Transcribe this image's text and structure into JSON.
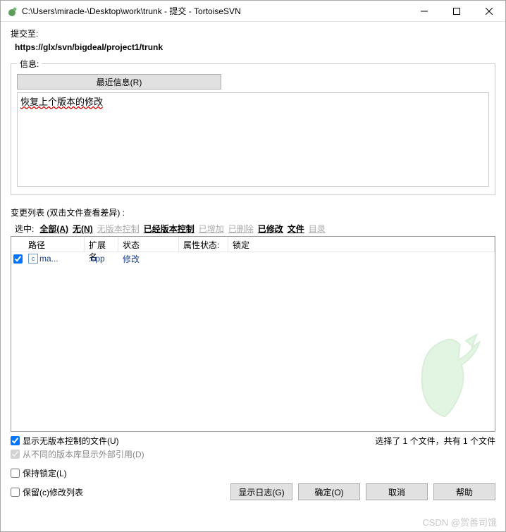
{
  "titlebar": {
    "text": "C:\\Users\\miracle-\\Desktop\\work\\trunk - 提交 - TortoiseSVN"
  },
  "commit": {
    "to_label": "提交至:",
    "url": "https://glx/svn/bigdeal/project1/trunk"
  },
  "info": {
    "legend": "信息:",
    "recent_btn": "最近信息(R)",
    "message": "恢复上个版本的修改"
  },
  "changelist": {
    "label": "变更列表  (双击文件查看差异) :",
    "filter_label": "选中:",
    "filters": [
      {
        "label": "全部(A)",
        "bold": true,
        "disabled": false
      },
      {
        "label": "无(N)",
        "bold": true,
        "disabled": false
      },
      {
        "label": "无版本控制",
        "bold": false,
        "disabled": true
      },
      {
        "label": "已经版本控制",
        "bold": true,
        "disabled": false
      },
      {
        "label": "已增加",
        "bold": false,
        "disabled": true
      },
      {
        "label": "已删除",
        "bold": false,
        "disabled": true
      },
      {
        "label": "已修改",
        "bold": true,
        "disabled": false
      },
      {
        "label": "文件",
        "bold": true,
        "disabled": false
      },
      {
        "label": "目录",
        "bold": false,
        "disabled": true
      }
    ]
  },
  "filelist": {
    "headers": {
      "path": "路径",
      "ext": "扩展名",
      "status": "状态",
      "propstatus": "属性状态:",
      "lock": "锁定"
    },
    "rows": [
      {
        "checked": true,
        "icon": "c",
        "name": "ma...",
        "ext": ".cpp",
        "status": "修改",
        "propstatus": "",
        "lock": ""
      }
    ]
  },
  "options": {
    "show_unversioned": "显示无版本控制的文件(U)",
    "show_externals": "从不同的版本库显示外部引用(D)",
    "keep_locks": "保持锁定(L)",
    "keep_changelist": "保留(c)修改列表"
  },
  "selection_info": "选择了 1 个文件，共有 1 个文件",
  "buttons": {
    "showlog": "显示日志(G)",
    "ok": "确定(O)",
    "cancel": "取消",
    "help": "帮助"
  },
  "watermark": "CSDN @赏善司饿"
}
